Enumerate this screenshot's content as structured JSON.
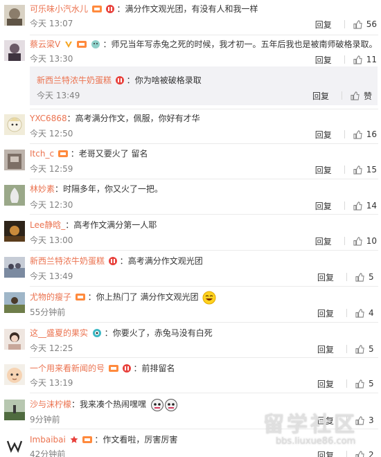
{
  "labels": {
    "reply": "回复",
    "like_zan": "赞"
  },
  "colors": {
    "username": "#eb7350",
    "text": "#333333",
    "meta": "#808080",
    "sub_bg": "#f2f2f5",
    "separator": "#eaeaea"
  },
  "comments": [
    {
      "user": "可乐味小汽水儿",
      "badges": [
        "member-icon",
        "red-badge-icon"
      ],
      "text": "满分作文观光团，有没有人和我一样",
      "time": "今天 13:07",
      "likes": "56"
    },
    {
      "user": "蔡云梁V",
      "badges": [
        "verified-v-icon",
        "member-icon",
        "emoji-badge-icon"
      ],
      "text": "师兄当年写赤兔之死的时候，我才初一。五年后我也是被南师破格录取。",
      "time": "今天 13:30",
      "likes": "11"
    },
    {
      "user": "新西兰特浓牛奶蛋糕",
      "badges": [
        "red-badge-icon"
      ],
      "text": "你为啥被破格录取",
      "time": "今天 13:49",
      "likes": "",
      "like_label": "赞",
      "is_reply": true
    },
    {
      "user": "YXC6868",
      "badges": [],
      "text": "高考满分作文，佩服，你好有才华",
      "time": "今天 12:50",
      "likes": "16"
    },
    {
      "user": "Itch_c",
      "badges": [
        "member-icon"
      ],
      "text": "老哥又要火了 留名",
      "time": "今天 12:59",
      "likes": "15"
    },
    {
      "user": "林妙素",
      "badges": [],
      "text": "时隔多年，你又火了一把。",
      "time": "今天 12:30",
      "likes": "14"
    },
    {
      "user": "Lee静晗_",
      "badges": [],
      "text": "高考作文满分第一人耶",
      "time": "今天 13:00",
      "likes": "10"
    },
    {
      "user": "新西兰特浓牛奶蛋糕",
      "badges": [
        "red-badge-icon"
      ],
      "text": "高考满分作文观光团",
      "time": "今天 13:49",
      "likes": "5"
    },
    {
      "user": "尤物的瘦子",
      "badges": [
        "member-icon"
      ],
      "text": "你上热门了 满分作文观光团",
      "emoji": "laugh-emoji-icon",
      "time": "55分钟前",
      "likes": "4"
    },
    {
      "user": "这__盛夏的果实",
      "badges": [
        "eye-badge-icon"
      ],
      "text": "你要火了，赤兔马没有白死",
      "time": "今天 12:25",
      "likes": "5"
    },
    {
      "user": "一个用来看新闻的号",
      "badges": [
        "member-icon",
        "red-badge-icon"
      ],
      "text": "前排留名",
      "time": "今天 13:19",
      "likes": "5"
    },
    {
      "user": "沙与沫柠檬",
      "badges": [],
      "text": "我来凑个热闹嘿嘿",
      "emoji": "doge-emoji-icon",
      "time": "9分钟前",
      "likes": "3"
    },
    {
      "user": "Imbaibai",
      "badges": [
        "star-icon",
        "member-icon"
      ],
      "text": "作文看啦，厉害厉害",
      "time": "42分钟前",
      "likes": "2"
    }
  ],
  "watermark": {
    "big": "留学社区",
    "small": "bbs.liuxue86.com"
  }
}
